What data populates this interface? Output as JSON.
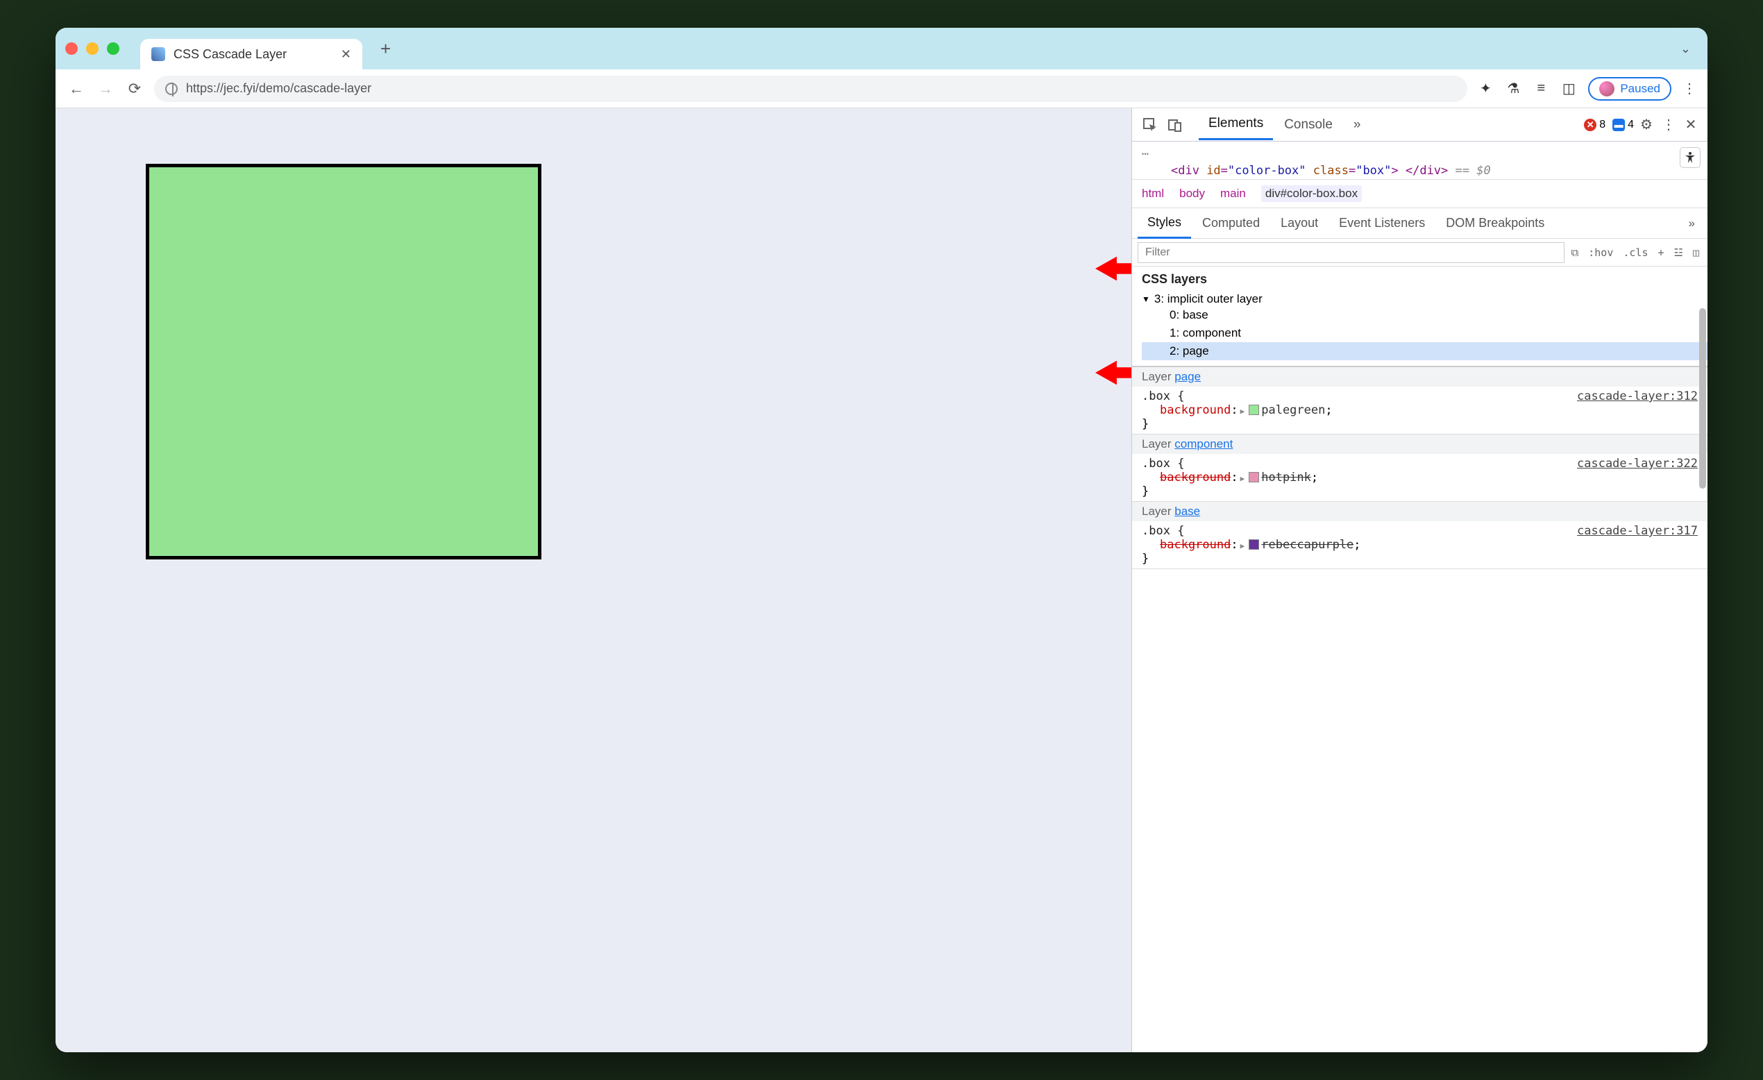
{
  "tab": {
    "title": "CSS Cascade Layer"
  },
  "url": "https://jec.fyi/demo/cascade-layer",
  "paused_label": "Paused",
  "devtools": {
    "top_tabs": {
      "elements": "Elements",
      "console": "Console"
    },
    "badges": {
      "errors": "8",
      "messages": "4"
    },
    "dom_line_prefix": "<div ",
    "dom_id_attr": "id",
    "dom_id_val": "\"color-box\"",
    "dom_class_attr": "class",
    "dom_class_val": "\"box\"",
    "dom_close": "> </div>",
    "dom_eq0": "== $0",
    "breadcrumb": [
      "html",
      "body",
      "main",
      "div#color-box.box"
    ],
    "subtabs": {
      "styles": "Styles",
      "computed": "Computed",
      "layout": "Layout",
      "listeners": "Event Listeners",
      "dom_bp": "DOM Breakpoints"
    },
    "filter_placeholder": "Filter",
    "filter_items": {
      "hov": ":hov",
      "cls": ".cls",
      "plus": "+"
    },
    "css_layers": {
      "heading": "CSS layers",
      "root": "3: implicit outer layer",
      "items": [
        "0: base",
        "1: component",
        "2: page"
      ]
    },
    "rules": [
      {
        "layer_label": "Layer ",
        "layer_link": "page",
        "selector": ".box",
        "src": "cascade-layer:312",
        "prop_name": "background",
        "prop_value": "palegreen",
        "swatch": "#98e698",
        "strike": false
      },
      {
        "layer_label": "Layer ",
        "layer_link": "component",
        "selector": ".box",
        "src": "cascade-layer:322",
        "prop_name": "background",
        "prop_value": "hotpink",
        "swatch": "#e893b3",
        "strike": true
      },
      {
        "layer_label": "Layer ",
        "layer_link": "base",
        "selector": ".box",
        "src": "cascade-layer:317",
        "prop_name": "background",
        "prop_value": "rebeccapurple",
        "swatch": "#663399",
        "strike": true
      }
    ]
  }
}
